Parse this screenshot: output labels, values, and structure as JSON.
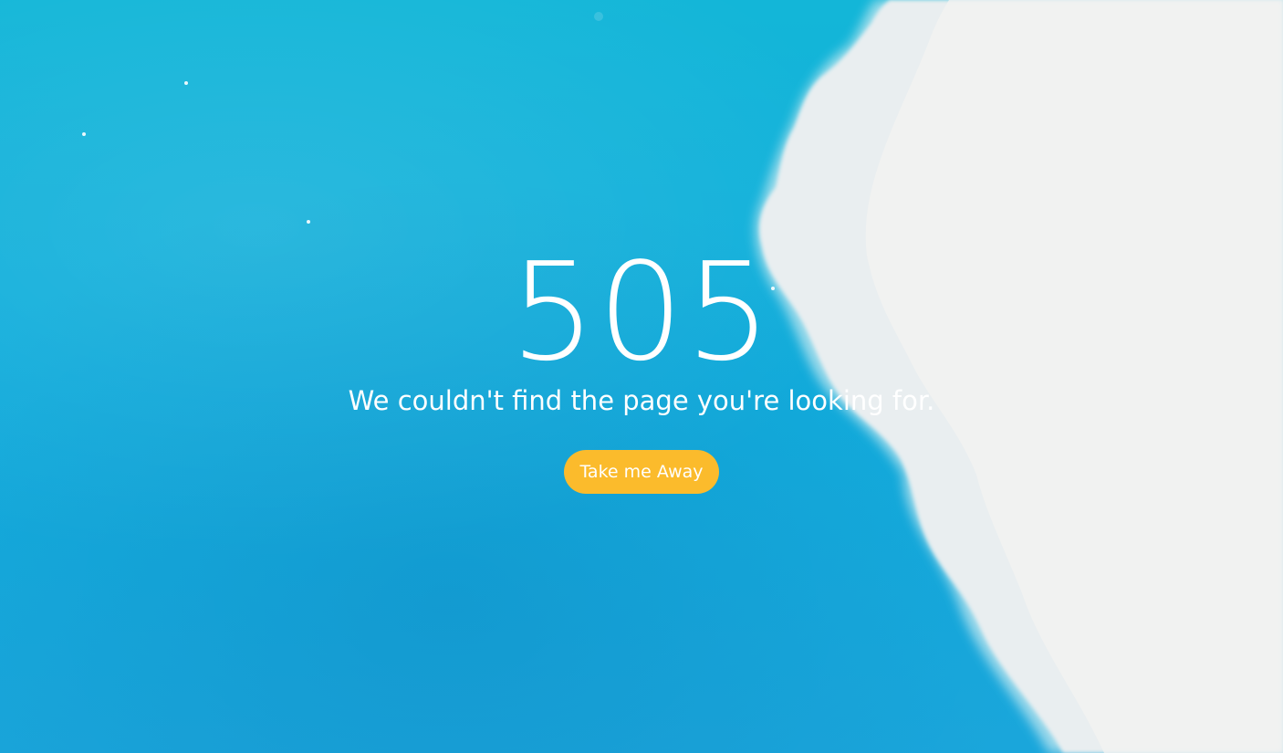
{
  "error": {
    "code": "505",
    "message": "We couldn't find the page you're looking for."
  },
  "actions": {
    "primary_label": "Take me Away"
  },
  "colors": {
    "ocean": "#13b0d9",
    "foam": "#ecf0f2",
    "button": "#fbbb2c",
    "text": "#ffffff"
  }
}
